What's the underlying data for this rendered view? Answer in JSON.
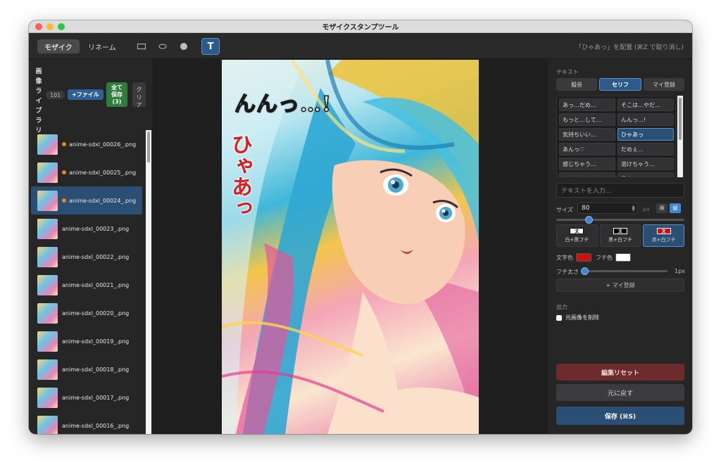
{
  "window": {
    "title": "モザイクスタンプツール"
  },
  "toolbar": {
    "tabs": [
      {
        "label": "モザイク",
        "active": true
      },
      {
        "label": "リネーム",
        "active": false
      }
    ],
    "tools": [
      "rectangle-icon",
      "ellipse-icon",
      "brush-dot-icon"
    ],
    "text_tool_label": "T",
    "hint": "「ひゃあっ」を配置 (⌘Z で取り消し)"
  },
  "library": {
    "label": "画像ライブラリ",
    "count": "101",
    "add_file_label": "+ファイル",
    "save_all_label": [
      "全て",
      "保存",
      "(3)"
    ],
    "clear_label": [
      "ク",
      "リ",
      "ア"
    ],
    "files": [
      {
        "name": "anime-sdxl_00026_.png",
        "modified": true,
        "selected": false
      },
      {
        "name": "anime-sdxl_00025_.png",
        "modified": true,
        "selected": false
      },
      {
        "name": "anime-sdxl_00024_.png",
        "modified": true,
        "selected": true
      },
      {
        "name": "anime-sdxl_00023_.png",
        "modified": false,
        "selected": false
      },
      {
        "name": "anime-sdxl_00022_.png",
        "modified": false,
        "selected": false
      },
      {
        "name": "anime-sdxl_00021_.png",
        "modified": false,
        "selected": false
      },
      {
        "name": "anime-sdxl_00020_.png",
        "modified": false,
        "selected": false
      },
      {
        "name": "anime-sdxl_00019_.png",
        "modified": false,
        "selected": false
      },
      {
        "name": "anime-sdxl_00018_.png",
        "modified": false,
        "selected": false
      },
      {
        "name": "anime-sdxl_00017_.png",
        "modified": false,
        "selected": false
      },
      {
        "name": "anime-sdxl_00016_.png",
        "modified": false,
        "selected": false
      }
    ]
  },
  "canvas": {
    "stamp_1": "んんっ…!",
    "stamp_2": "ひゃあっ"
  },
  "panel": {
    "text_section_label": "テキスト",
    "categories": [
      {
        "label": "擬音",
        "active": false
      },
      {
        "label": "セリフ",
        "active": true
      },
      {
        "label": "マイ登録",
        "active": false
      }
    ],
    "phrases": [
      {
        "label": "あっ…だめ…",
        "active": false
      },
      {
        "label": "そこは…やだ…",
        "active": false
      },
      {
        "label": "もっと…して…",
        "active": false
      },
      {
        "label": "んんっ…!",
        "active": false
      },
      {
        "label": "気持ちいい…",
        "active": false
      },
      {
        "label": "ひゃあっ",
        "active": true
      },
      {
        "label": "あんっ♡",
        "active": false
      },
      {
        "label": "だめぇ…",
        "active": false
      },
      {
        "label": "感じちゃう…",
        "active": false
      },
      {
        "label": "溶けちゃう…",
        "active": false
      },
      {
        "label": "もうイク…",
        "active": false
      },
      {
        "label": "見ないで…",
        "active": false
      }
    ],
    "text_placeholder": "テキストを入力...",
    "size_label": "サイズ",
    "size_value": "80",
    "size_unit": "px",
    "orientation": [
      {
        "label": "横",
        "active": false
      },
      {
        "label": "縦",
        "active": true
      }
    ],
    "size_slider_fraction": 0.25,
    "presets": [
      {
        "swatch": "文",
        "label": "白+黒フチ",
        "fill": "#ffffff",
        "stroke": "#000000",
        "text": "#000000",
        "active": false
      },
      {
        "swatch": "文",
        "label": "黒+白フチ",
        "fill": "#000000",
        "stroke": "#ffffff",
        "text": "#ffffff",
        "active": false
      },
      {
        "swatch": "文",
        "label": "赤+白フチ",
        "fill": "#cc1111",
        "stroke": "#ffffff",
        "text": "#ffffff",
        "active": true
      }
    ],
    "text_color_label": "文字色",
    "text_color": "#cc1111",
    "edge_color_label": "フチ色",
    "edge_color": "#ffffff",
    "edge_width_label": "フチ太さ",
    "edge_width_value": "1px",
    "edge_slider_fraction": 0.0,
    "add_my_label": "+ マイ登録",
    "output_label": "出力",
    "delete_original_label": "元画像を削除",
    "reset_label": "編集リセット",
    "undo_label": "元に戻す",
    "save_label": "保存 (⌘S)"
  },
  "colors": {
    "accent": "#2d5a8a",
    "save_all": "#2f7d3b",
    "reset": "#6e2a2c",
    "modified_dot": "#e08a1e"
  }
}
